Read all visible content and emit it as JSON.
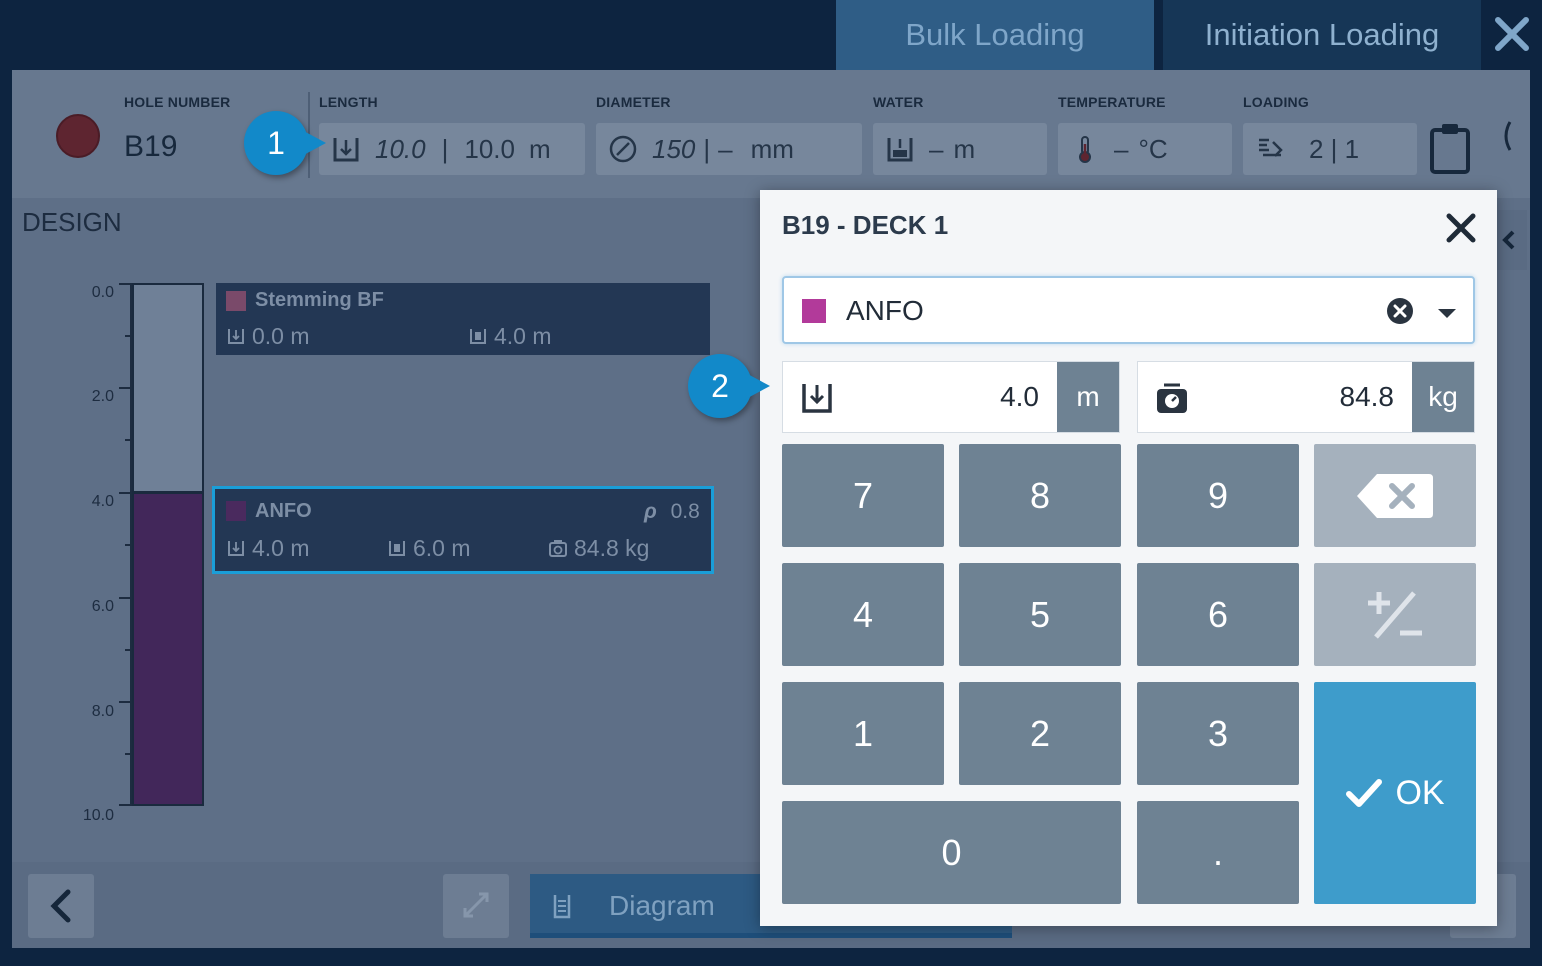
{
  "tabs": [
    {
      "label": "Bulk Loading",
      "active": true
    },
    {
      "label": "Initiation Loading",
      "active": false
    }
  ],
  "header": {
    "hole_number_label": "HOLE NUMBER",
    "hole_number": "B19",
    "status_color": "#5e2530",
    "length": {
      "label": "LENGTH",
      "design": "10.0",
      "separator": "|",
      "actual": "10.0",
      "unit": "m"
    },
    "diameter": {
      "label": "DIAMETER",
      "design": "150",
      "separator": "|",
      "actual": "–",
      "unit": "mm"
    },
    "water": {
      "label": "WATER",
      "value": "–",
      "unit": "m"
    },
    "temperature": {
      "label": "TEMPERATURE",
      "value": "–",
      "unit": "°C"
    },
    "loading": {
      "label": "LOADING",
      "value": "2 | 1"
    }
  },
  "design": {
    "title": "DESIGN",
    "axis_ticks": [
      "0.0",
      "2.0",
      "4.0",
      "6.0",
      "8.0",
      "10.0"
    ],
    "decks": [
      {
        "name": "Stemming BF",
        "color": "#7a4a6a",
        "top": "0.0 m",
        "length": "4.0 m"
      },
      {
        "name": "ANFO",
        "color": "#4a2a5e",
        "density_label": "ρ",
        "density": "0.8",
        "top": "4.0 m",
        "length": "6.0 m",
        "mass": "84.8 kg"
      }
    ]
  },
  "bottom": {
    "diagram_label": "Diagram"
  },
  "modal": {
    "title": "B19 - DECK 1",
    "product": {
      "name": "ANFO",
      "color": "#b23a9a"
    },
    "length": {
      "value": "4.0",
      "unit": "m"
    },
    "mass": {
      "value": "84.8",
      "unit": "kg"
    },
    "keys": {
      "k7": "7",
      "k8": "8",
      "k9": "9",
      "k4": "4",
      "k5": "5",
      "k6": "6",
      "k1": "1",
      "k2": "2",
      "k3": "3",
      "k0": "0",
      "dot": ".",
      "ok": "OK"
    }
  },
  "callouts": [
    "1",
    "2"
  ],
  "colors": {
    "accent": "#1289c9",
    "ok": "#3e9ccb",
    "key": "#6e8293"
  }
}
